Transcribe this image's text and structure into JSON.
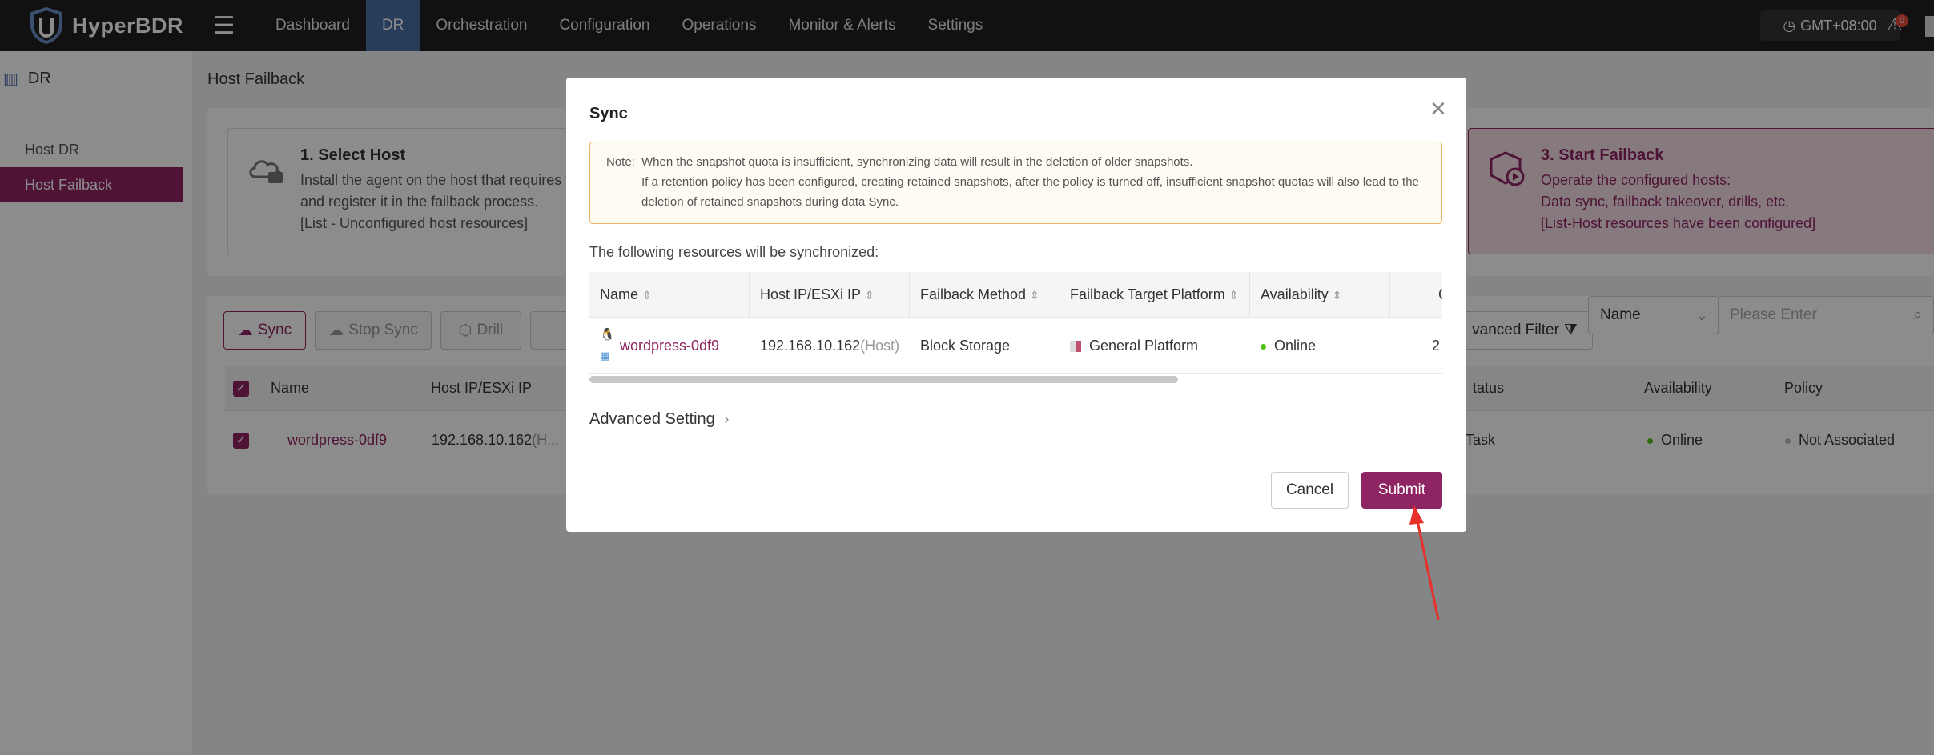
{
  "app": {
    "name": "HyperBDR"
  },
  "nav": {
    "items": [
      "Dashboard",
      "DR",
      "Orchestration",
      "Configuration",
      "Operations",
      "Monitor & Alerts",
      "Settings"
    ],
    "active": "DR"
  },
  "header": {
    "timezone": "GMT+08:00",
    "alert_count": "0"
  },
  "sidebar": {
    "title": "DR",
    "items": [
      {
        "label": "Host DR"
      },
      {
        "label": "Host Failback"
      }
    ],
    "active": "Host Failback"
  },
  "page": {
    "title": "Host Failback",
    "steps": [
      {
        "title": "1. Select Host",
        "lines": [
          "Install the agent on the host that requires fa",
          "and register it in the failback process.",
          "[List - Unconfigured host resources]"
        ]
      },
      {
        "title": "3. Start Failback",
        "lines": [
          "Operate the configured hosts:",
          "Data sync, failback takeover, drills, etc.",
          "[List-Host resources have been configured]"
        ]
      }
    ],
    "toolbar": {
      "sync": "Sync",
      "stop_sync": "Stop Sync",
      "drill": "Drill",
      "advanced_filter": "vanced Filter",
      "filter_field": "Name",
      "filter_placeholder": "Please Enter"
    },
    "table": {
      "headers": {
        "name": "Name",
        "ip": "Host IP/ESXi IP",
        "status": "tatus",
        "availability": "Availability",
        "policy": "Policy"
      },
      "rows": [
        {
          "name": "wordpress-0df9",
          "ip": "192.168.10.162",
          "ip_suffix": "(H...",
          "status": "Task",
          "availability": "Online",
          "policy": "Not Associated"
        }
      ]
    }
  },
  "modal": {
    "title": "Sync",
    "note_label": "Note:",
    "note_lines": [
      "When the snapshot quota is insufficient, synchronizing data will result in the deletion of older snapshots.",
      "If a retention policy has been configured, creating retained snapshots, after the policy is turned off, insufficient snapshot quotas will also lead to the",
      "deletion of retained snapshots during data Sync."
    ],
    "resources_title": "The following resources will be synchronized:",
    "columns": [
      "Name",
      "Host IP/ESXi IP",
      "Failback Method",
      "Failback Target Platform",
      "Availability",
      "C"
    ],
    "row": {
      "name": "wordpress-0df9",
      "ip": "192.168.10.162",
      "ip_suffix": "(Host)",
      "method": "Block Storage",
      "platform": "General Platform",
      "availability": "Online",
      "extra": "2"
    },
    "advanced": "Advanced Setting",
    "cancel": "Cancel",
    "submit": "Submit"
  },
  "colors": {
    "brand": "#8e2461",
    "online": "#52c41a",
    "nav_active": "#4a6fa5"
  },
  "annotation": {
    "arrow_color": "#e8302a",
    "points_to": "Submit"
  }
}
